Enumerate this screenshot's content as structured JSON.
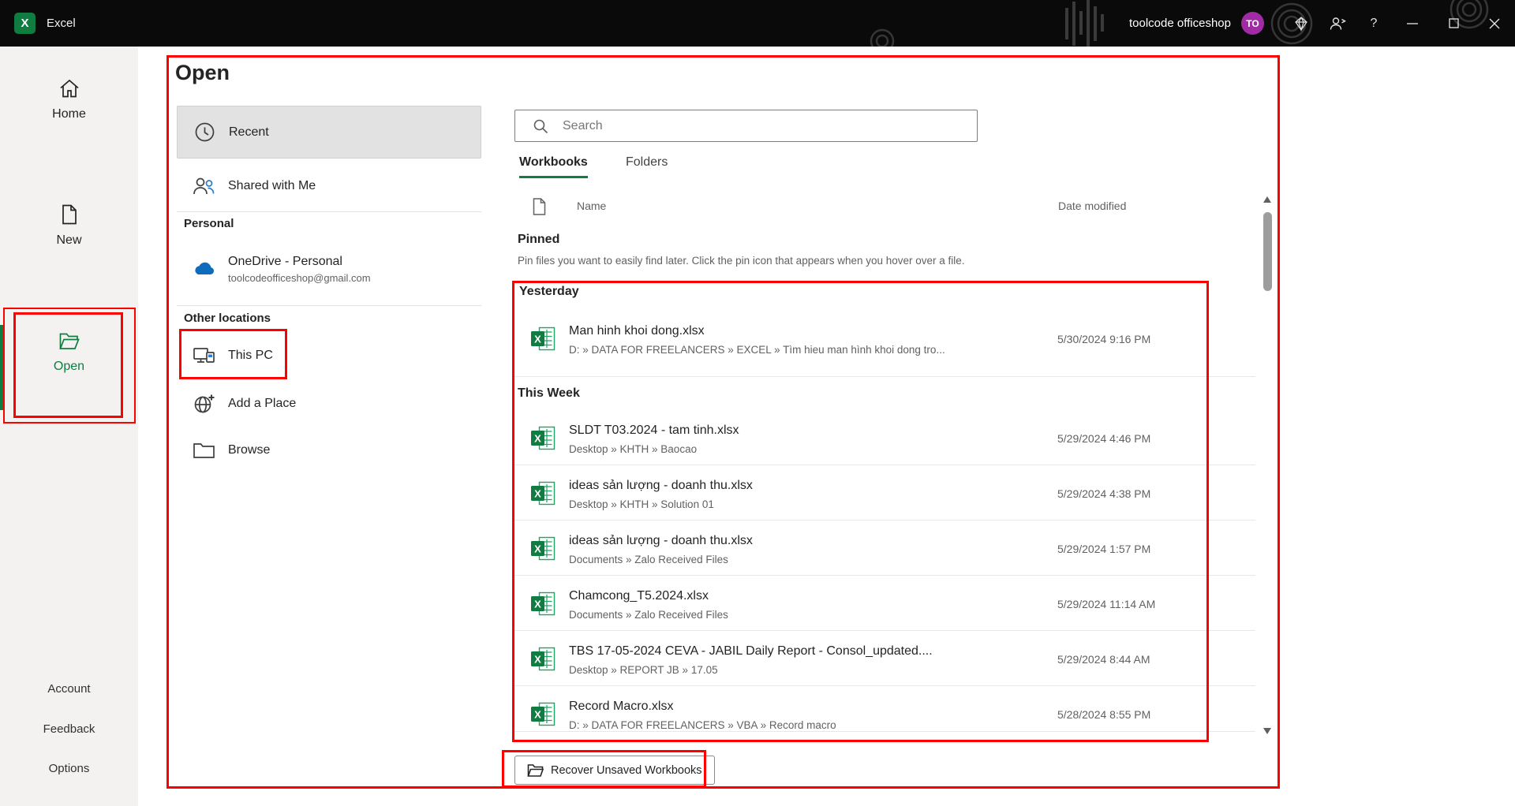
{
  "titlebar": {
    "app_name": "Excel",
    "logo_letter": "X",
    "account_name": "toolcode officeshop",
    "avatar_initials": "TO",
    "help_label": "?"
  },
  "sidebar": {
    "nav": [
      {
        "label": "Home"
      },
      {
        "label": "New"
      },
      {
        "label": "Open",
        "active": true
      }
    ],
    "footer": [
      {
        "label": "Account"
      },
      {
        "label": "Feedback"
      },
      {
        "label": "Options"
      }
    ]
  },
  "open_page": {
    "title": "Open",
    "locations": {
      "recent": "Recent",
      "shared": "Shared with Me",
      "personal_header": "Personal",
      "onedrive_label": "OneDrive - Personal",
      "onedrive_email": "toolcodeofficeshop@gmail.com",
      "other_header": "Other locations",
      "this_pc": "This PC",
      "add_place": "Add a Place",
      "browse": "Browse"
    },
    "search_placeholder": "Search",
    "tabs": {
      "workbooks": "Workbooks",
      "folders": "Folders"
    },
    "columns": {
      "name": "Name",
      "date_modified": "Date modified"
    },
    "pinned": {
      "header": "Pinned",
      "description": "Pin files you want to easily find later. Click the pin icon that appears when you hover over a file."
    },
    "sections": [
      {
        "header": "Yesterday",
        "files": [
          {
            "name": "Man hinh khoi dong.xlsx",
            "path": "D: » DATA FOR FREELANCERS » EXCEL » Tìm hieu man hình khoi dong tro...",
            "date": "5/30/2024 9:16 PM"
          }
        ]
      },
      {
        "header": "This Week",
        "files": [
          {
            "name": "SLDT T03.2024 - tam tinh.xlsx",
            "path": "Desktop » KHTH » Baocao",
            "date": "5/29/2024 4:46 PM"
          },
          {
            "name": "ideas sản lượng - doanh thu.xlsx",
            "path": "Desktop » KHTH » Solution 01",
            "date": "5/29/2024 4:38 PM"
          },
          {
            "name": "ideas sản lượng - doanh thu.xlsx",
            "path": "Documents » Zalo Received Files",
            "date": "5/29/2024 1:57 PM"
          },
          {
            "name": "Chamcong_T5.2024.xlsx",
            "path": "Documents » Zalo Received Files",
            "date": "5/29/2024 11:14 AM"
          },
          {
            "name": "TBS 17-05-2024 CEVA - JABIL Daily Report - Consol_updated....",
            "path": "Desktop » REPORT JB » 17.05",
            "date": "5/29/2024 8:44 AM"
          },
          {
            "name": "Record Macro.xlsx",
            "path": "D: » DATA FOR FREELANCERS » VBA » Record macro",
            "date": "5/28/2024 8:55 PM"
          }
        ]
      }
    ],
    "recover_button": "Recover Unsaved Workbooks"
  },
  "colors": {
    "accent_green": "#107C41",
    "annotation_red": "#FF0000",
    "avatar_purple": "#A12BA5",
    "onedrive_blue": "#0F6CBD",
    "titlebar_black": "#0A0A0A",
    "sidebar_gray": "#F3F2F1"
  }
}
